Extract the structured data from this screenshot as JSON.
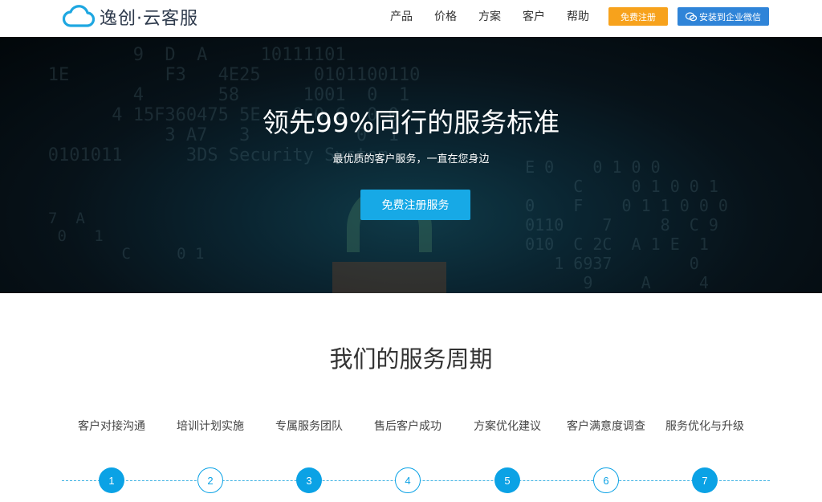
{
  "header": {
    "brand": "逸创·云客服",
    "nav": [
      "产品",
      "价格",
      "方案",
      "客户",
      "帮助"
    ],
    "register_label": "免费注册",
    "wechat_label": "安装到企业微信",
    "accent_orange": "#f7a21c",
    "accent_blue": "#2f84d8"
  },
  "hero": {
    "title": "领先99%同行的服务标准",
    "subtitle": "最优质的客户服务，一直在您身边",
    "cta_label": "免费注册服务",
    "cta_color": "#17a9e6"
  },
  "cycle": {
    "title": "我们的服务周期",
    "steps": [
      {
        "label": "客户对接沟通",
        "number": "1",
        "style": "filled"
      },
      {
        "label": "培训计划实施",
        "number": "2",
        "style": "hollow"
      },
      {
        "label": "专属服务团队",
        "number": "3",
        "style": "filled"
      },
      {
        "label": "售后客户成功",
        "number": "4",
        "style": "hollow"
      },
      {
        "label": "方案优化建议",
        "number": "5",
        "style": "filled"
      },
      {
        "label": "客户满意度调查",
        "number": "6",
        "style": "hollow"
      },
      {
        "label": "服务优化与升级",
        "number": "7",
        "style": "filled"
      }
    ],
    "accent": "#0ba2e5"
  }
}
